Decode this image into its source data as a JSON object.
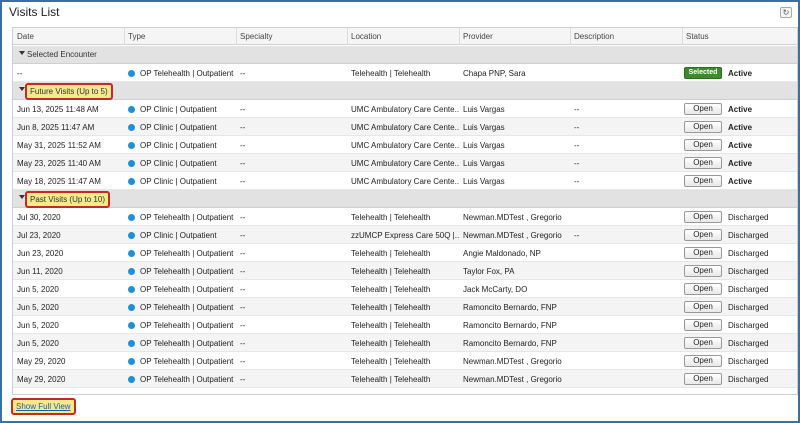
{
  "window": {
    "title": "Visits List",
    "refresh_icon": "refresh-icon"
  },
  "columns": [
    "Date",
    "Type",
    "Specialty",
    "Location",
    "Provider",
    "Description",
    "Status"
  ],
  "groups": {
    "selected": {
      "label": "Selected Encounter"
    },
    "future": {
      "label": "Future Visits (Up to 5)"
    },
    "past": {
      "label": "Past Visits (Up to 10)"
    }
  },
  "selected_rows": [
    {
      "date": "--",
      "type": "OP Telehealth | Outpatient",
      "specialty": "--",
      "location": "Telehealth | Telehealth",
      "provider": "Chapa PNP, Sara",
      "description": "",
      "button": "Selected",
      "status": "Active"
    }
  ],
  "future_rows": [
    {
      "date": "Jun 13, 2025 11:48 AM",
      "type": "OP Clinic | Outpatient",
      "specialty": "--",
      "location": "UMC Ambulatory Care Cente...",
      "provider": "Luis Vargas",
      "description": "--",
      "button": "Open",
      "status": "Active"
    },
    {
      "date": "Jun 8, 2025 11:47 AM",
      "type": "OP Clinic | Outpatient",
      "specialty": "--",
      "location": "UMC Ambulatory Care Cente...",
      "provider": "Luis Vargas",
      "description": "--",
      "button": "Open",
      "status": "Active"
    },
    {
      "date": "May 31, 2025 11:52 AM",
      "type": "OP Clinic | Outpatient",
      "specialty": "--",
      "location": "UMC Ambulatory Care Cente...",
      "provider": "Luis Vargas",
      "description": "--",
      "button": "Open",
      "status": "Active"
    },
    {
      "date": "May 23, 2025 11:40 AM",
      "type": "OP Clinic | Outpatient",
      "specialty": "--",
      "location": "UMC Ambulatory Care Cente...",
      "provider": "Luis Vargas",
      "description": "--",
      "button": "Open",
      "status": "Active"
    },
    {
      "date": "May 18, 2025 11:47 AM",
      "type": "OP Clinic | Outpatient",
      "specialty": "--",
      "location": "UMC Ambulatory Care Cente...",
      "provider": "Luis Vargas",
      "description": "--",
      "button": "Open",
      "status": "Active"
    }
  ],
  "past_rows": [
    {
      "date": "Jul 30, 2020",
      "type": "OP Telehealth | Outpatient",
      "specialty": "--",
      "location": "Telehealth | Telehealth",
      "provider": "Newman.MDTest , Gregorio",
      "description": "",
      "button": "Open",
      "status": "Discharged"
    },
    {
      "date": "Jul 23, 2020",
      "type": "OP Clinic | Outpatient",
      "specialty": "--",
      "location": "zzUMCP Express Care 50Q |...",
      "provider": "Newman.MDTest , Gregorio",
      "description": "--",
      "button": "Open",
      "status": "Discharged"
    },
    {
      "date": "Jun 23, 2020",
      "type": "OP Telehealth | Outpatient",
      "specialty": "--",
      "location": "Telehealth | Telehealth",
      "provider": "Angie Maldonado, NP",
      "description": "",
      "button": "Open",
      "status": "Discharged"
    },
    {
      "date": "Jun 11, 2020",
      "type": "OP Telehealth | Outpatient",
      "specialty": "--",
      "location": "Telehealth | Telehealth",
      "provider": "Taylor Fox, PA",
      "description": "",
      "button": "Open",
      "status": "Discharged"
    },
    {
      "date": "Jun 5, 2020",
      "type": "OP Telehealth | Outpatient",
      "specialty": "--",
      "location": "Telehealth | Telehealth",
      "provider": "Jack McCarty, DO",
      "description": "",
      "button": "Open",
      "status": "Discharged"
    },
    {
      "date": "Jun 5, 2020",
      "type": "OP Telehealth | Outpatient",
      "specialty": "--",
      "location": "Telehealth | Telehealth",
      "provider": "Ramoncito Bernardo, FNP",
      "description": "",
      "button": "Open",
      "status": "Discharged"
    },
    {
      "date": "Jun 5, 2020",
      "type": "OP Telehealth | Outpatient",
      "specialty": "--",
      "location": "Telehealth | Telehealth",
      "provider": "Ramoncito Bernardo, FNP",
      "description": "",
      "button": "Open",
      "status": "Discharged"
    },
    {
      "date": "Jun 5, 2020",
      "type": "OP Telehealth | Outpatient",
      "specialty": "--",
      "location": "Telehealth | Telehealth",
      "provider": "Ramoncito Bernardo, FNP",
      "description": "",
      "button": "Open",
      "status": "Discharged"
    },
    {
      "date": "May 29, 2020",
      "type": "OP Telehealth | Outpatient",
      "specialty": "--",
      "location": "Telehealth | Telehealth",
      "provider": "Newman.MDTest , Gregorio",
      "description": "",
      "button": "Open",
      "status": "Discharged"
    },
    {
      "date": "May 29, 2020",
      "type": "OP Telehealth | Outpatient",
      "specialty": "--",
      "location": "Telehealth | Telehealth",
      "provider": "Newman.MDTest , Gregorio",
      "description": "",
      "button": "Open",
      "status": "Discharged"
    }
  ],
  "footer": {
    "link_label": "Show Full View"
  },
  "colors": {
    "accent": "#3a6ea5",
    "type_dot": "#1f8fd6",
    "selected_button": "#3c8c2e",
    "highlight_border": "#c62828",
    "highlight_fill": "#f4e98b"
  }
}
